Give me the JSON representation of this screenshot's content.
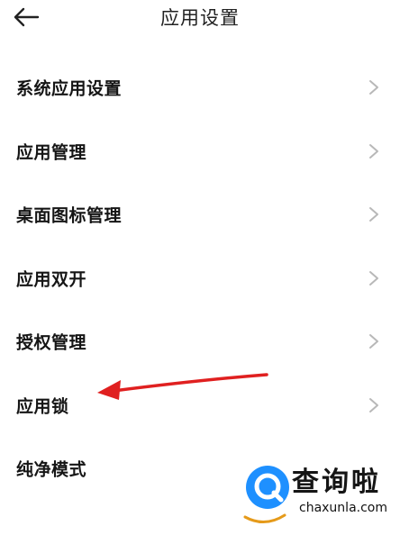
{
  "header": {
    "back_icon": "arrow-left-icon",
    "title": "应用设置"
  },
  "menu": {
    "items": [
      {
        "label": "系统应用设置"
      },
      {
        "label": "应用管理"
      },
      {
        "label": "桌面图标管理"
      },
      {
        "label": "应用双开"
      },
      {
        "label": "授权管理"
      },
      {
        "label": "应用锁"
      },
      {
        "label": "纯净模式"
      }
    ],
    "chevron_icon": "chevron-right-icon"
  },
  "annotation": {
    "arrow_color": "#e02020",
    "points_to": "应用锁"
  },
  "watermark": {
    "name": "查询啦",
    "domain": "chaxunla.com",
    "logo_color": "#1e90ff",
    "underline_color": "#e59a1a"
  },
  "colors": {
    "background": "#ffffff",
    "text": "#151515",
    "chevron": "#b8b8b8"
  }
}
